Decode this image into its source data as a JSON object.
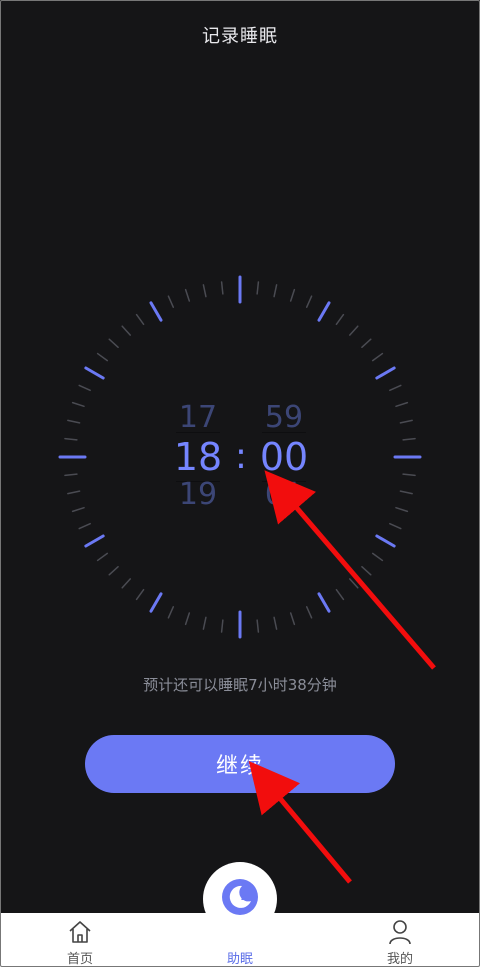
{
  "header": {
    "title": "记录睡眠"
  },
  "time_picker": {
    "hour": {
      "prev": "17",
      "current": "18",
      "next": "19"
    },
    "minute": {
      "prev": "59",
      "current": "00",
      "next": "01"
    },
    "separator": ":"
  },
  "estimate_text": "预计还可以睡眠7小时38分钟",
  "continue_button": {
    "label": "继续"
  },
  "tab_bar": {
    "items": [
      {
        "label": "首页",
        "icon": "home-icon",
        "active": false
      },
      {
        "label": "助眠",
        "icon": "sleep-moon-icon",
        "active": true
      },
      {
        "label": "我的",
        "icon": "user-icon",
        "active": false
      }
    ]
  },
  "colors": {
    "background": "#151517",
    "accent": "#6b79f4",
    "tick": "#4a4b52",
    "annotation_arrow": "#f20d0d"
  }
}
